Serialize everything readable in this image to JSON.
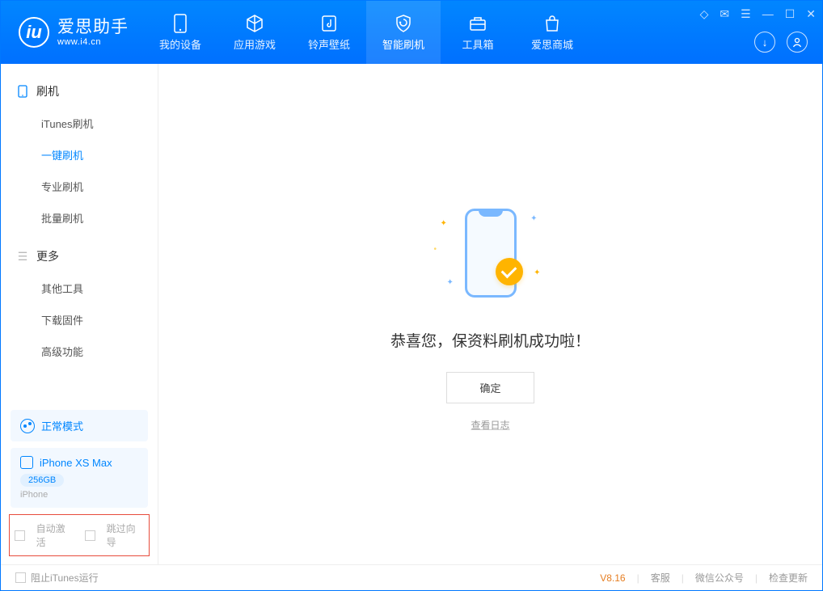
{
  "app": {
    "name": "爱思助手",
    "url": "www.i4.cn"
  },
  "tabs": [
    {
      "label": "我的设备",
      "icon": "device"
    },
    {
      "label": "应用游戏",
      "icon": "cube"
    },
    {
      "label": "铃声壁纸",
      "icon": "music"
    },
    {
      "label": "智能刷机",
      "icon": "shield"
    },
    {
      "label": "工具箱",
      "icon": "toolbox"
    },
    {
      "label": "爱思商城",
      "icon": "bag"
    }
  ],
  "active_tab": 3,
  "sidebar": {
    "group1_title": "刷机",
    "group1_items": [
      "iTunes刷机",
      "一键刷机",
      "专业刷机",
      "批量刷机"
    ],
    "active_item": 1,
    "group2_title": "更多",
    "group2_items": [
      "其他工具",
      "下载固件",
      "高级功能"
    ]
  },
  "mode": {
    "label": "正常模式"
  },
  "device": {
    "name": "iPhone XS Max",
    "storage": "256GB",
    "type": "iPhone"
  },
  "checks": {
    "auto_activate": "自动激活",
    "skip_guide": "跳过向导"
  },
  "result": {
    "message": "恭喜您，保资料刷机成功啦！",
    "ok": "确定",
    "log": "查看日志"
  },
  "footer": {
    "block_itunes": "阻止iTunes运行",
    "version": "V8.16",
    "links": [
      "客服",
      "微信公众号",
      "检查更新"
    ]
  }
}
